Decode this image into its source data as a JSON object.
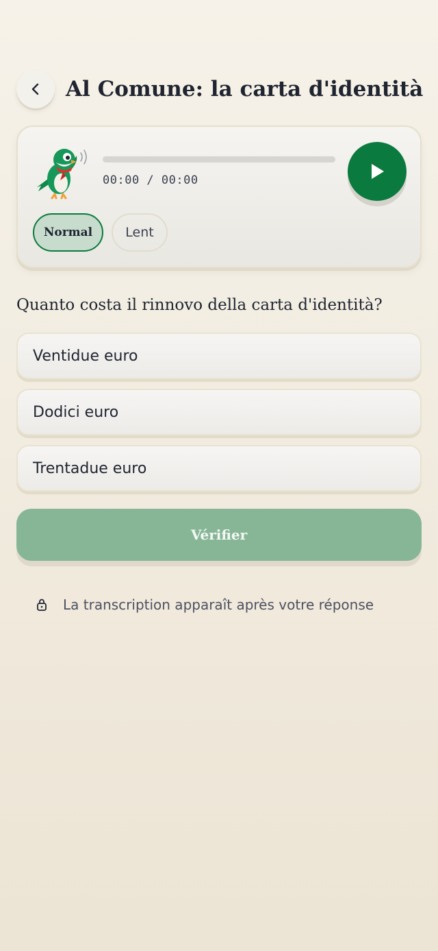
{
  "header": {
    "back_icon": "chevron-left-icon",
    "title": "Al Comune: la carta d'identità"
  },
  "player": {
    "mascot": "green-bird-mascot",
    "progress": 0,
    "time": "00:00 / 00:00",
    "play_icon": "play-icon",
    "speeds": [
      "Normal",
      "Lent"
    ],
    "selected_speed": "Normal"
  },
  "quiz": {
    "question": "Quanto costa il rinnovo della carta d'identità?",
    "options": [
      "Ventidue euro",
      "Dodici euro",
      "Trentadue euro"
    ],
    "verify_label": "Vérifier"
  },
  "notice": {
    "icon": "lock-icon",
    "text": "La transcription apparaît après votre réponse"
  },
  "colors": {
    "accent": "#0b7a3e",
    "verify_disabled": "#87b697",
    "background": "#f3eee3"
  }
}
